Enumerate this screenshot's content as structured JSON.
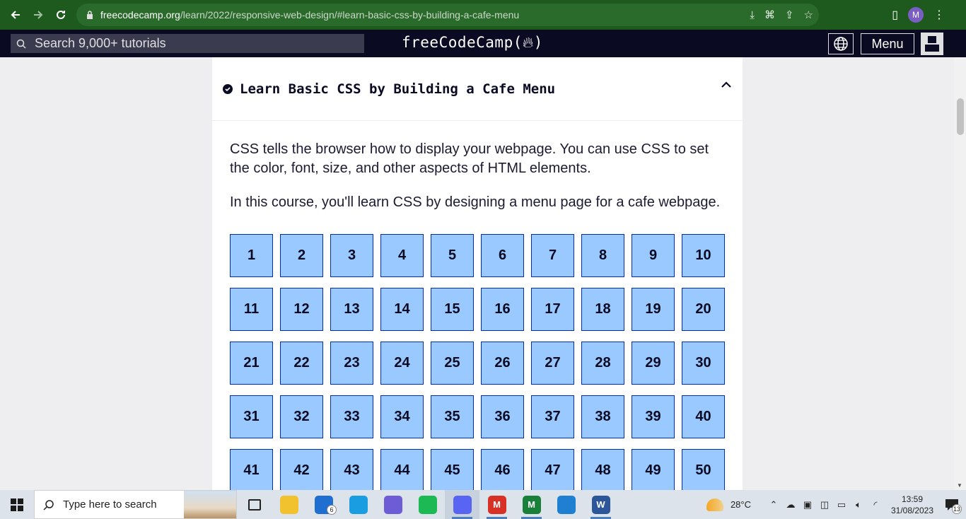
{
  "browser": {
    "url_host": "freecodecamp.org",
    "url_path": "/learn/2022/responsive-web-design/#learn-basic-css-by-building-a-cafe-menu",
    "profile_initial": "M"
  },
  "fcc_nav": {
    "search_placeholder": "Search 9,000+ tutorials",
    "logo_text": "freeCodeCamp(",
    "logo_suffix": ")",
    "menu_label": "Menu"
  },
  "block": {
    "title": "Learn Basic CSS by Building a Cafe Menu",
    "description_1": "CSS tells the browser how to display your webpage. You can use CSS to set the color, font, size, and other aspects of HTML elements.",
    "description_2": "In this course, you'll learn CSS by designing a menu page for a cafe webpage.",
    "steps": [
      "1",
      "2",
      "3",
      "4",
      "5",
      "6",
      "7",
      "8",
      "9",
      "10",
      "11",
      "12",
      "13",
      "14",
      "15",
      "16",
      "17",
      "18",
      "19",
      "20",
      "21",
      "22",
      "23",
      "24",
      "25",
      "26",
      "27",
      "28",
      "29",
      "30",
      "31",
      "32",
      "33",
      "34",
      "35",
      "36",
      "37",
      "38",
      "39",
      "40",
      "41",
      "42",
      "43",
      "44",
      "45",
      "46",
      "47",
      "48",
      "49",
      "50"
    ]
  },
  "taskbar": {
    "search_placeholder": "Type here to search",
    "apps": [
      {
        "name": "task-view",
        "color": "#dde3ea",
        "glyph": ""
      },
      {
        "name": "file-explorer",
        "color": "#f2c12e",
        "glyph": ""
      },
      {
        "name": "mail",
        "color": "#1f6fd1",
        "glyph": "",
        "badge": "6"
      },
      {
        "name": "edge",
        "color": "#1b9de2",
        "glyph": ""
      },
      {
        "name": "app-hex",
        "color": "#6e5bd6",
        "glyph": ""
      },
      {
        "name": "spotify",
        "color": "#1db954",
        "glyph": ""
      },
      {
        "name": "discord",
        "color": "#5865f2",
        "glyph": ""
      },
      {
        "name": "chrome-1",
        "color": "#d93025",
        "glyph": "M"
      },
      {
        "name": "chrome-2",
        "color": "#188038",
        "glyph": "M"
      },
      {
        "name": "vscode",
        "color": "#1f7fd1",
        "glyph": ""
      },
      {
        "name": "word",
        "color": "#2b579a",
        "glyph": "W"
      }
    ],
    "weather": "28°C",
    "time": "13:59",
    "date": "31/08/2023",
    "notifications": "13"
  }
}
